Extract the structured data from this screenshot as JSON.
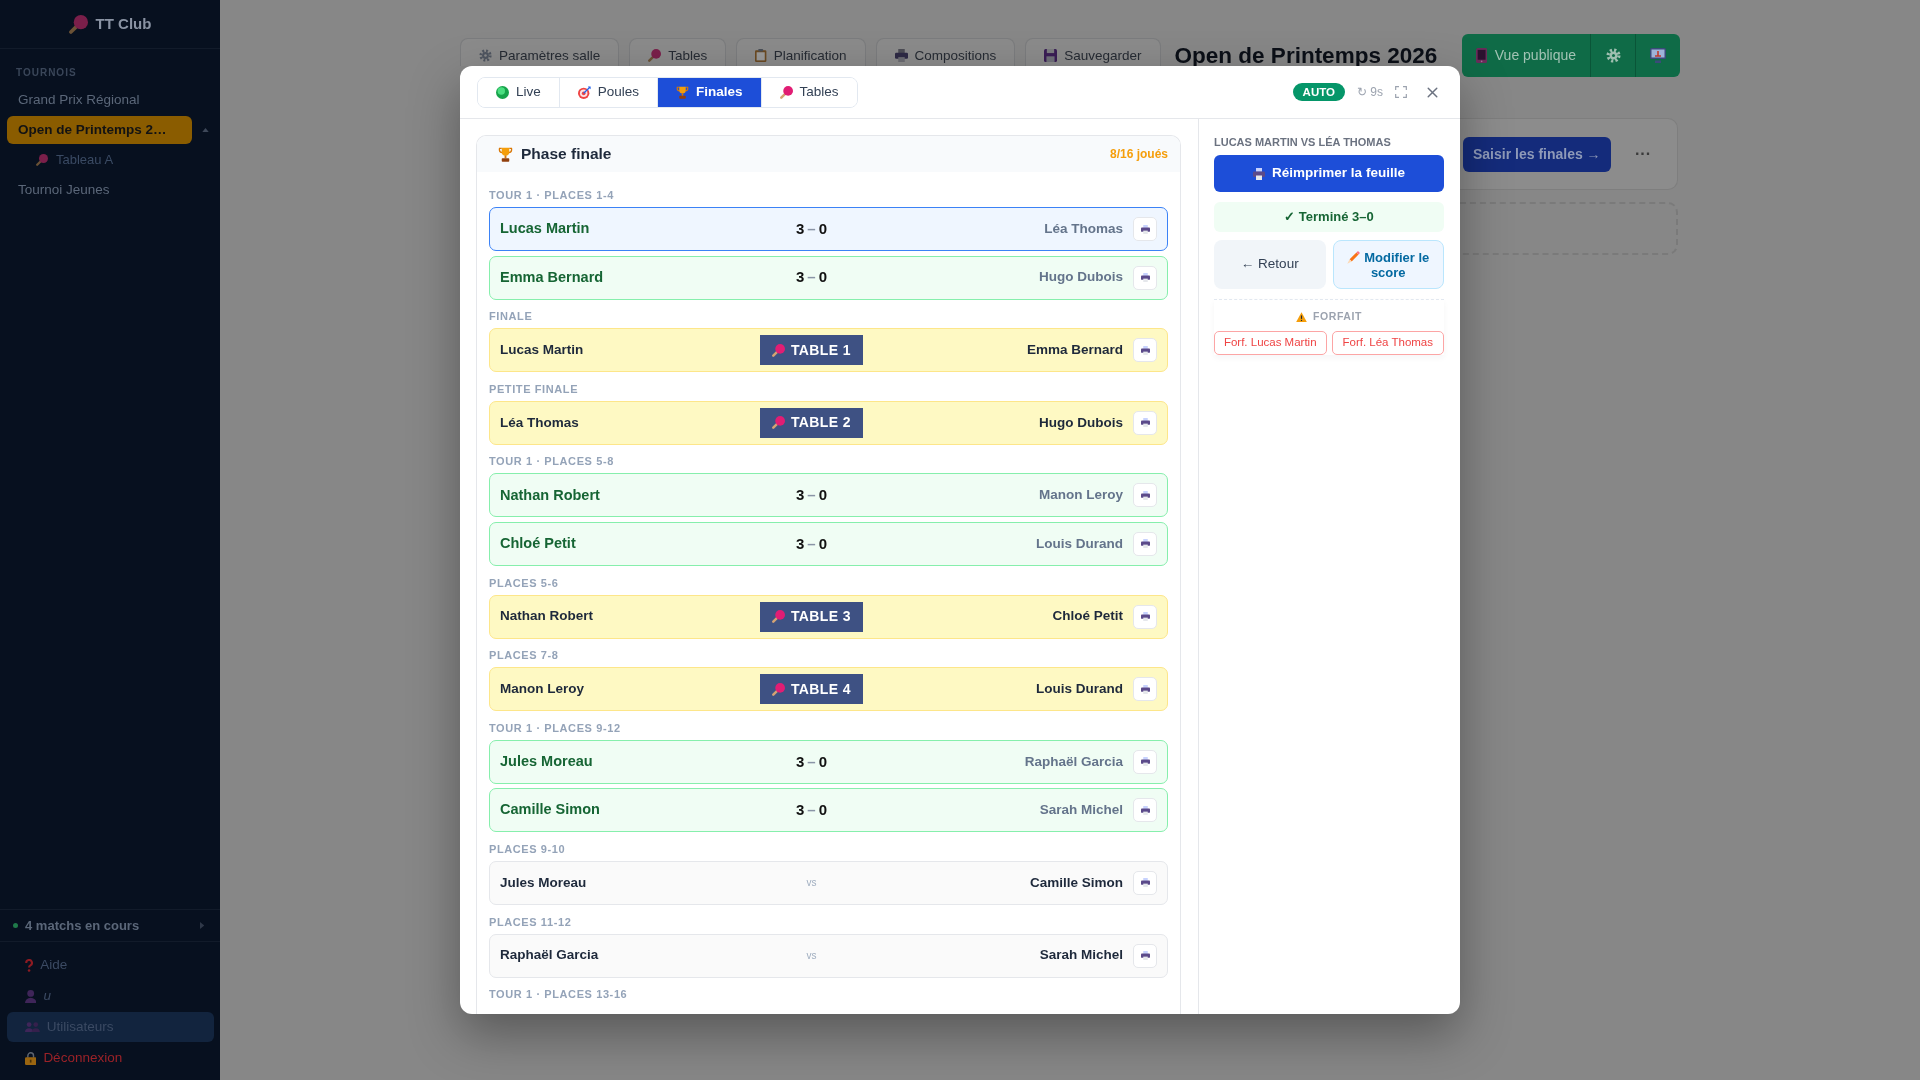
{
  "sidebar": {
    "brand": "TT Club",
    "section_label": "TOURNOIS",
    "tournaments": [
      {
        "name": "Grand Prix Régional",
        "selected": false
      },
      {
        "name": "Open de Printemps 2…",
        "selected": true,
        "expanded": true,
        "children": [
          {
            "name": "Tableau A",
            "selected": false
          }
        ]
      },
      {
        "name": "Tournoi Jeunes",
        "selected": false
      }
    ],
    "live_summary": {
      "label": "4 matchs en cours",
      "expanded": false
    },
    "footer_items": [
      {
        "kind": "help",
        "label": "Aide",
        "selected": false
      },
      {
        "kind": "user",
        "label": "u",
        "selected": false
      },
      {
        "kind": "users",
        "label": "Utilisateurs",
        "selected": true
      },
      {
        "kind": "logout",
        "label": "Déconnexion",
        "selected": false
      }
    ]
  },
  "toolbar": {
    "buttons": [
      {
        "kind": "settings",
        "label": "Paramètres salle"
      },
      {
        "kind": "tables",
        "label": "Tables"
      },
      {
        "kind": "planning",
        "label": "Planification"
      },
      {
        "kind": "print",
        "label": "Compositions"
      },
      {
        "kind": "save",
        "label": "Sauvegarder"
      }
    ],
    "title": "Open de Printemps 2026",
    "public_view_button": "Vue publique"
  },
  "finals_panel": {
    "enter_button": "Saisir les finales →",
    "more_button": "···"
  },
  "modal": {
    "tabs": [
      {
        "kind": "live",
        "label": "Live",
        "selected": false
      },
      {
        "kind": "pools",
        "label": "Poules",
        "selected": false
      },
      {
        "kind": "finals",
        "label": "Finales",
        "selected": true
      },
      {
        "kind": "tables",
        "label": "Tables",
        "selected": false
      }
    ],
    "auto_badge": "AUTO",
    "refresh": "↻ 9s",
    "bracket": {
      "title": "Phase finale",
      "progress": "8/16 joués",
      "groups": [
        {
          "label": "TOUR 1 · PLACES 1-4",
          "matches": [
            {
              "kind": "played",
              "home": "Lucas Martin",
              "away": "Léa Thomas",
              "home_won": true,
              "score": {
                "home": "3",
                "sep": "–",
                "away": "0"
              },
              "selected": true
            },
            {
              "kind": "played",
              "home": "Emma Bernard",
              "away": "Hugo Dubois",
              "home_won": true,
              "score": {
                "home": "3",
                "sep": "–",
                "away": "0"
              },
              "selected": false
            }
          ]
        },
        {
          "label": "FINALE",
          "matches": [
            {
              "kind": "live",
              "home": "Lucas Martin",
              "away": "Emma Bernard",
              "table": "TABLE 1",
              "selected": false
            }
          ]
        },
        {
          "label": "PETITE FINALE",
          "matches": [
            {
              "kind": "live",
              "home": "Léa Thomas",
              "away": "Hugo Dubois",
              "table": "TABLE 2",
              "selected": false
            }
          ]
        },
        {
          "label": "TOUR 1 · PLACES 5-8",
          "matches": [
            {
              "kind": "played",
              "home": "Nathan Robert",
              "away": "Manon Leroy",
              "home_won": true,
              "score": {
                "home": "3",
                "sep": "–",
                "away": "0"
              },
              "selected": false
            },
            {
              "kind": "played",
              "home": "Chloé Petit",
              "away": "Louis Durand",
              "home_won": true,
              "score": {
                "home": "3",
                "sep": "–",
                "away": "0"
              },
              "selected": false
            }
          ]
        },
        {
          "label": "PLACES 5-6",
          "matches": [
            {
              "kind": "live",
              "home": "Nathan Robert",
              "away": "Chloé Petit",
              "table": "TABLE 3",
              "selected": false
            }
          ]
        },
        {
          "label": "PLACES 7-8",
          "matches": [
            {
              "kind": "live",
              "home": "Manon Leroy",
              "away": "Louis Durand",
              "table": "TABLE 4",
              "selected": false
            }
          ]
        },
        {
          "label": "TOUR 1 · PLACES 9-12",
          "matches": [
            {
              "kind": "played",
              "home": "Jules Moreau",
              "away": "Raphaël Garcia",
              "home_won": true,
              "score": {
                "home": "3",
                "sep": "–",
                "away": "0"
              },
              "selected": false
            },
            {
              "kind": "played",
              "home": "Camille Simon",
              "away": "Sarah Michel",
              "home_won": true,
              "score": {
                "home": "3",
                "sep": "–",
                "away": "0"
              },
              "selected": false
            }
          ]
        },
        {
          "label": "PLACES 9-10",
          "matches": [
            {
              "kind": "pending",
              "home": "Jules Moreau",
              "away": "Camille Simon",
              "vs": "vs",
              "selected": false
            }
          ]
        },
        {
          "label": "PLACES 11-12",
          "matches": [
            {
              "kind": "pending",
              "home": "Raphaël Garcia",
              "away": "Sarah Michel",
              "vs": "vs",
              "selected": false
            }
          ]
        },
        {
          "label": "TOUR 1 · PLACES 13-16"
        }
      ]
    },
    "detail": {
      "title": "LUCAS MARTIN VS LÉA THOMAS",
      "reprint_button": "Réimprimer la feuille",
      "status": "✓ Terminé 3–0",
      "back_button": "← Retour",
      "edit_button": "Modifier le score",
      "forfeit": {
        "label": "FORFAIT",
        "buttons": [
          "Forf. Lucas Martin",
          "Forf. Léa Thomas"
        ]
      }
    }
  }
}
